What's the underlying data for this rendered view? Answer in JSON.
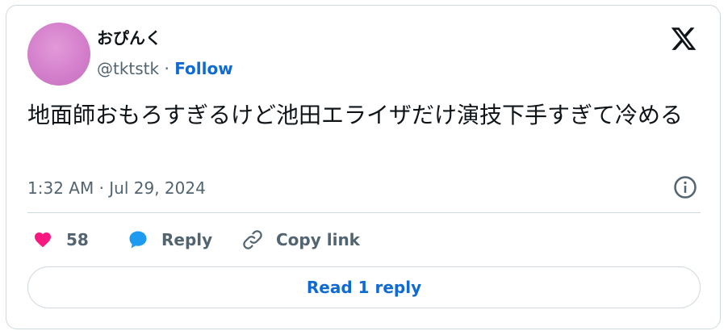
{
  "author": {
    "display_name": "おぴんく",
    "handle": "@tktstk",
    "separator": "·",
    "follow_label": "Follow"
  },
  "tweet": {
    "text": "地面師おもろすぎるけど池田エライザだけ演技下手すぎて冷める",
    "timestamp": "1:32 AM · Jul 29, 2024"
  },
  "actions": {
    "like_count": "58",
    "reply_label": "Reply",
    "copy_link_label": "Copy link"
  },
  "read_replies_label": "Read 1 reply",
  "colors": {
    "accent": "#0f6bd2",
    "heart": "#f91880",
    "reply_bubble": "#1d9bf0",
    "muted_text": "#536471",
    "border": "#cfd9de",
    "avatar": "#d47fcb"
  },
  "icons": {
    "platform_logo": "x-logo-icon",
    "info": "info-icon",
    "like": "heart-icon",
    "reply": "speech-bubble-icon",
    "copy_link": "link-icon"
  }
}
